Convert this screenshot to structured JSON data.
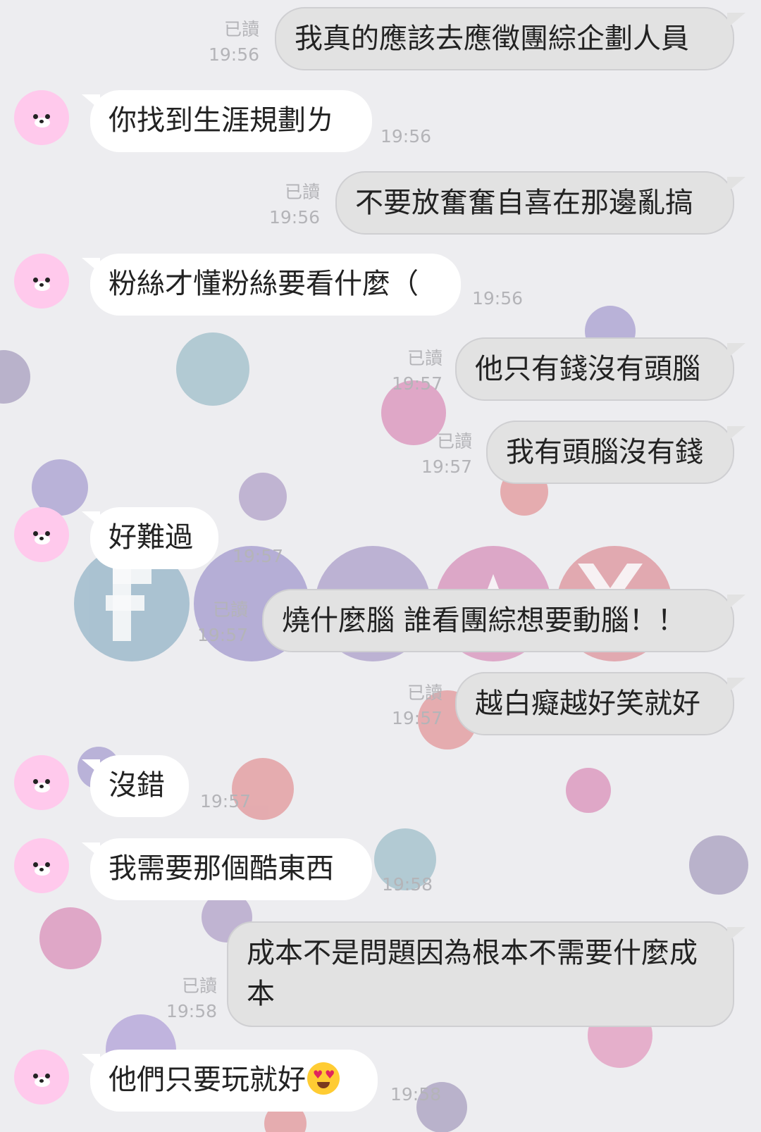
{
  "chat": {
    "read_label": "已讀",
    "messages": [
      {
        "id": "m1",
        "side": "out",
        "text": "我真的應該去應徵團綜企劃人員",
        "time": "19:56",
        "read": true
      },
      {
        "id": "m2",
        "side": "in",
        "text": "你找到生涯規劃ㄌ",
        "time": "19:56"
      },
      {
        "id": "m3",
        "side": "out",
        "text": "不要放奮奮自喜在那邊亂搞",
        "time": "19:56",
        "read": true
      },
      {
        "id": "m4",
        "side": "in",
        "text": "粉絲才懂粉絲要看什麼（",
        "time": "19:56"
      },
      {
        "id": "m5",
        "side": "out",
        "text": "他只有錢沒有頭腦",
        "time": "19:57",
        "read": true
      },
      {
        "id": "m6",
        "side": "out",
        "text": "我有頭腦沒有錢",
        "time": "19:57",
        "read": true
      },
      {
        "id": "m7",
        "side": "in",
        "text": "好難過",
        "time": "19:57"
      },
      {
        "id": "m8",
        "side": "out",
        "text": "燒什麼腦  誰看團綜想要動腦！！",
        "time": "19:57",
        "read": true
      },
      {
        "id": "m9",
        "side": "out",
        "text": "越白癡越好笑就好",
        "time": "19:57",
        "read": true
      },
      {
        "id": "m10",
        "side": "in",
        "text": "沒錯",
        "time": "19:57"
      },
      {
        "id": "m11",
        "side": "in",
        "text": "我需要那個酷東西",
        "time": "19:58"
      },
      {
        "id": "m12",
        "side": "out",
        "text": "成本不是問題因為根本不需要什麼成本",
        "time": "19:58",
        "read": true
      },
      {
        "id": "m13",
        "side": "in",
        "text": "他們只要玩就好",
        "emoji": "heart-eyes-emoji",
        "time": "19:58"
      }
    ]
  },
  "colors": {
    "background": "#ededf0",
    "incoming_bubble": "#ffffff",
    "outgoing_bubble": "#e2e2e2",
    "meta_text": "#b4b4b8",
    "avatar": "#ffc9ec"
  }
}
